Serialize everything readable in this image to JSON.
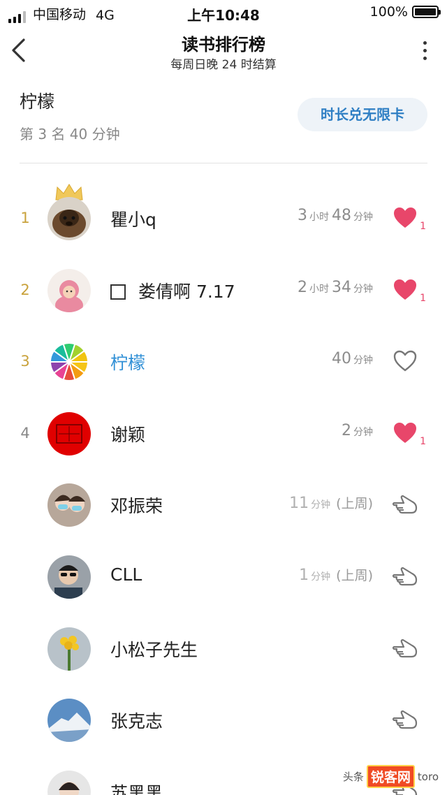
{
  "status_bar": {
    "carrier": "中国移动",
    "network": "4G",
    "time": "上午10:48",
    "battery": "100%"
  },
  "nav": {
    "title": "读书排行榜",
    "subtitle": "每周日晚 24 时结算"
  },
  "me": {
    "name": "柠檬",
    "rank_text": "第 3 名  40 分钟",
    "redeem_label": "时长兑无限卡"
  },
  "colors": {
    "accent": "#2f8fd6",
    "rank_gold": "#c9a23c",
    "like_red": "#e8466a",
    "button_bg": "#eef3f8"
  },
  "rows": [
    {
      "rank": "1",
      "name": "瞿小q",
      "h": "3",
      "h_unit": "小时",
      "m": "48",
      "m_unit": "分钟",
      "action_icon": "heart-filled-icon",
      "likes": "1",
      "avatar": "dog-photo"
    },
    {
      "rank": "2",
      "name": "娄倩啊 7.17",
      "h": "2",
      "h_unit": "小时",
      "m": "34",
      "m_unit": "分钟",
      "action_icon": "heart-filled-icon",
      "likes": "1",
      "avatar": "child-photo"
    },
    {
      "rank": "3",
      "name": "柠檬",
      "m": "40",
      "m_unit": "分钟",
      "action_icon": "heart-outline-icon",
      "avatar": "lemon-slice"
    },
    {
      "rank": "4",
      "name": "谢颖",
      "m": "2",
      "m_unit": "分钟",
      "action_icon": "heart-filled-icon",
      "likes": "1",
      "avatar": "red-stamp"
    },
    {
      "name": "邓振荣",
      "m": "11",
      "m_unit": "分钟",
      "prev": "(上周)",
      "action_icon": "poke-hand-icon",
      "avatar": "couple-photo"
    },
    {
      "name": "CLL",
      "m": "1",
      "m_unit": "分钟",
      "prev": "(上周)",
      "action_icon": "poke-hand-icon",
      "avatar": "sunglasses-photo"
    },
    {
      "name": "小松子先生",
      "action_icon": "poke-hand-icon",
      "avatar": "flowers-photo"
    },
    {
      "name": "张克志",
      "action_icon": "poke-hand-icon",
      "avatar": "mountain-photo"
    },
    {
      "name": "苏黑黑",
      "action_icon": "poke-hand-icon",
      "avatar": "portrait-photo"
    }
  ],
  "watermark": {
    "prefix": "头条",
    "badge": "锐客网",
    "suffix": "toro"
  }
}
